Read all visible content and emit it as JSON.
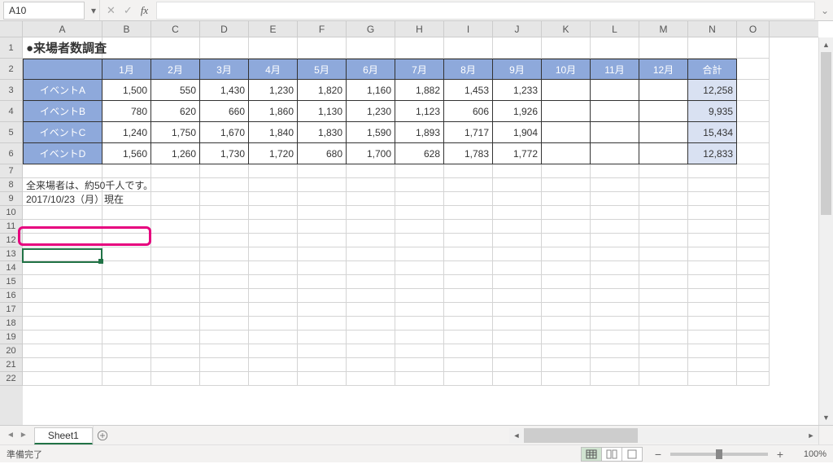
{
  "name_box": "A10",
  "formula_value": "",
  "columns": [
    "A",
    "B",
    "C",
    "D",
    "E",
    "F",
    "G",
    "H",
    "I",
    "J",
    "K",
    "L",
    "M",
    "N",
    "O"
  ],
  "rows": [
    1,
    2,
    3,
    4,
    5,
    6,
    7,
    8,
    9,
    10,
    11,
    12,
    13,
    14,
    15,
    16,
    17,
    18,
    19,
    20,
    21,
    22
  ],
  "title": "●来場者数調査",
  "months": [
    "1月",
    "2月",
    "3月",
    "4月",
    "5月",
    "6月",
    "7月",
    "8月",
    "9月",
    "10月",
    "11月",
    "12月",
    "合計"
  ],
  "events": [
    {
      "label": "イベントA",
      "vals": [
        "1,500",
        "550",
        "1,430",
        "1,230",
        "1,820",
        "1,160",
        "1,882",
        "1,453",
        "1,233",
        "",
        "",
        ""
      ],
      "total": "12,258"
    },
    {
      "label": "イベントB",
      "vals": [
        "780",
        "620",
        "660",
        "1,860",
        "1,130",
        "1,230",
        "1,123",
        "606",
        "1,926",
        "",
        "",
        ""
      ],
      "total": "9,935"
    },
    {
      "label": "イベントC",
      "vals": [
        "1,240",
        "1,750",
        "1,670",
        "1,840",
        "1,830",
        "1,590",
        "1,893",
        "1,717",
        "1,904",
        "",
        "",
        ""
      ],
      "total": "15,434"
    },
    {
      "label": "イベントD",
      "vals": [
        "1,560",
        "1,260",
        "1,730",
        "1,720",
        "680",
        "1,700",
        "628",
        "1,783",
        "1,772",
        "",
        "",
        ""
      ],
      "total": "12,833"
    }
  ],
  "note8": "全来場者は、約50千人です。",
  "note9": "2017/10/23（月）現在",
  "tab": "Sheet1",
  "status": "準備完了",
  "zoom": "100%"
}
